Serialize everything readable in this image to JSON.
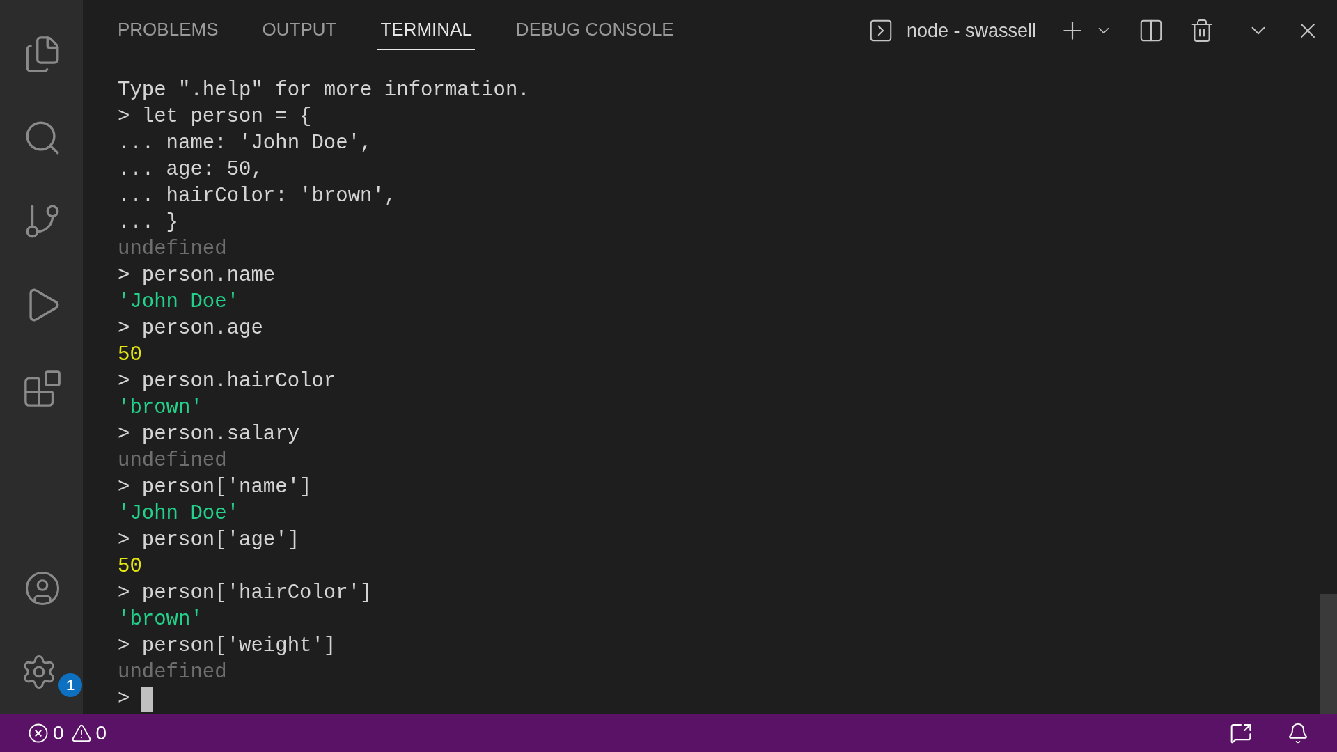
{
  "activity_bar": {
    "items": [
      {
        "kind": "explorer",
        "selected": false
      },
      {
        "kind": "search",
        "selected": false
      },
      {
        "kind": "source-control",
        "selected": false
      },
      {
        "kind": "run",
        "selected": false
      },
      {
        "kind": "extensions",
        "selected": false
      }
    ],
    "bottom": [
      {
        "kind": "account"
      },
      {
        "kind": "settings",
        "badge": "1"
      }
    ]
  },
  "panel": {
    "tabs": [
      {
        "label": "PROBLEMS",
        "selected": false
      },
      {
        "label": "OUTPUT",
        "selected": false
      },
      {
        "label": "TERMINAL",
        "selected": true
      },
      {
        "label": "DEBUG CONSOLE",
        "selected": false
      }
    ],
    "terminal_name": "node - swassell"
  },
  "terminal": {
    "lines": [
      {
        "kind": "text",
        "text": "Type \".help\" for more information."
      },
      {
        "kind": "input",
        "text": "> let person = {"
      },
      {
        "kind": "input",
        "text": "... name: 'John Doe',"
      },
      {
        "kind": "input",
        "text": "... age: 50,"
      },
      {
        "kind": "input",
        "text": "... hairColor: 'brown',"
      },
      {
        "kind": "input",
        "text": "... }"
      },
      {
        "kind": "undefined",
        "text": "undefined"
      },
      {
        "kind": "input",
        "text": "> person.name"
      },
      {
        "kind": "string",
        "text": "'John Doe'"
      },
      {
        "kind": "input",
        "text": "> person.age"
      },
      {
        "kind": "number",
        "text": "50"
      },
      {
        "kind": "input",
        "text": "> person.hairColor"
      },
      {
        "kind": "string",
        "text": "'brown'"
      },
      {
        "kind": "input",
        "text": "> person.salary"
      },
      {
        "kind": "undefined",
        "text": "undefined"
      },
      {
        "kind": "input",
        "text": "> person['name']"
      },
      {
        "kind": "string",
        "text": "'John Doe'"
      },
      {
        "kind": "input",
        "text": "> person['age']"
      },
      {
        "kind": "number",
        "text": "50"
      },
      {
        "kind": "input",
        "text": "> person['hairColor']"
      },
      {
        "kind": "string",
        "text": "'brown'"
      },
      {
        "kind": "input",
        "text": "> person['weight']"
      },
      {
        "kind": "undefined",
        "text": "undefined"
      }
    ],
    "prompt": ">"
  },
  "status_bar": {
    "errors": "0",
    "warnings": "0"
  }
}
